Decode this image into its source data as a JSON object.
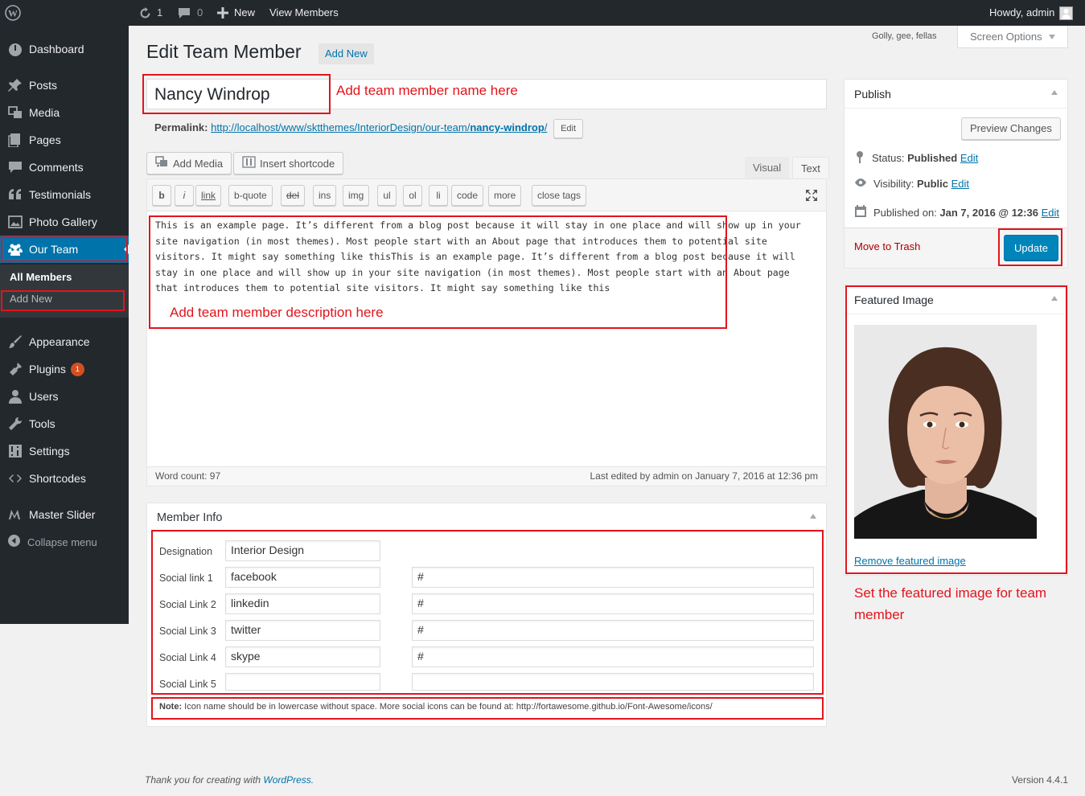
{
  "adminbar": {
    "updates_count": "1",
    "comments_count": "0",
    "new_label": "New",
    "view_label": "View Members",
    "howdy": "Howdy, admin"
  },
  "sidebar": {
    "items": [
      {
        "label": "Dashboard",
        "icon": "dashboard-icon"
      },
      {
        "label": "Posts",
        "icon": "pin-icon"
      },
      {
        "label": "Media",
        "icon": "media-icon"
      },
      {
        "label": "Pages",
        "icon": "pages-icon"
      },
      {
        "label": "Comments",
        "icon": "comment-icon"
      },
      {
        "label": "Testimonials",
        "icon": "quote-icon"
      },
      {
        "label": "Photo Gallery",
        "icon": "gallery-icon"
      },
      {
        "label": "Our Team",
        "icon": "team-icon"
      },
      {
        "label": "Appearance",
        "icon": "brush-icon"
      },
      {
        "label": "Plugins",
        "icon": "plug-icon"
      },
      {
        "label": "Users",
        "icon": "user-icon"
      },
      {
        "label": "Tools",
        "icon": "wrench-icon"
      },
      {
        "label": "Settings",
        "icon": "settings-icon"
      },
      {
        "label": "Shortcodes",
        "icon": "code-icon"
      },
      {
        "label": "Master Slider",
        "icon": "slider-icon"
      }
    ],
    "submenu": [
      "All Members",
      "Add New"
    ],
    "plugins_badge": "1",
    "collapse_label": "Collapse menu"
  },
  "top_right": {
    "hello_dolly": "Golly, gee, fellas",
    "screen_options": "Screen Options"
  },
  "main": {
    "title": "Edit Team Member",
    "add_new": "Add New",
    "post_title": "Nancy Windrop",
    "permalink_label": "Permalink:",
    "permalink_url": "http://localhost/www/sktthemes/InteriorDesign/our-team/",
    "permalink_slug": "nancy-windrop",
    "permalink_end": "/",
    "permalink_edit": "Edit",
    "add_media": "Add Media",
    "insert_shortcode": "Insert shortcode",
    "tab_visual": "Visual",
    "tab_text": "Text",
    "quicktags": [
      "b",
      "i",
      "link",
      "b-quote",
      "del",
      "ins",
      "img",
      "ul",
      "ol",
      "li",
      "code",
      "more",
      "close tags"
    ],
    "content_lines": [
      "This is an example page. It’s different from a blog post because it will stay in one place and will show up in your",
      "site navigation (in most themes). Most people start with an About page that introduces them to potential site",
      "visitors. It might say something like thisThis is an example page. It’s different from a blog post because it will",
      "stay in one place and will show up in your site navigation (in most themes). Most people start with an About page",
      "that introduces them to potential site visitors. It might say something like this"
    ],
    "word_count": "Word count: 97",
    "last_edited": "Last edited by admin on January 7, 2016 at 12:36 pm"
  },
  "member_info": {
    "title": "Member Info",
    "rows": [
      {
        "label": "Designation",
        "value": "Interior Design",
        "link": null
      },
      {
        "label": "Social link 1",
        "value": "facebook",
        "link": "#"
      },
      {
        "label": "Social Link 2",
        "value": "linkedin",
        "link": "#"
      },
      {
        "label": "Social Link 3",
        "value": "twitter",
        "link": "#"
      },
      {
        "label": "Social Link 4",
        "value": "skype",
        "link": "#"
      },
      {
        "label": "Social Link 5",
        "value": "",
        "link": ""
      }
    ],
    "note_bold": "Note:",
    "note_text": " Icon name should be in lowercase without space. More social icons can be found at: http://fortawesome.github.io/Font-Awesome/icons/"
  },
  "publish": {
    "title": "Publish",
    "preview": "Preview Changes",
    "status_label": "Status:",
    "status_value": "Published",
    "visibility_label": "Visibility:",
    "visibility_value": "Public",
    "published_label": "Published on:",
    "published_value": "Jan 7, 2016 @ 12:36",
    "edit": "Edit",
    "trash": "Move to Trash",
    "update": "Update"
  },
  "featured": {
    "title": "Featured Image",
    "remove": "Remove featured image"
  },
  "annotations": {
    "name": "Add team member name here",
    "description": "Add team member description here",
    "featured_line1": "Set the featured image for team",
    "featured_line2": "member"
  },
  "footer": {
    "thanks_prefix": "Thank you for creating with ",
    "thanks_link": "WordPress",
    "thanks_suffix": ".",
    "version": "Version 4.4.1"
  },
  "colors": {
    "accent": "#0073aa",
    "annotation_red": "#e2141c",
    "sidebar_bg": "#23282d"
  }
}
